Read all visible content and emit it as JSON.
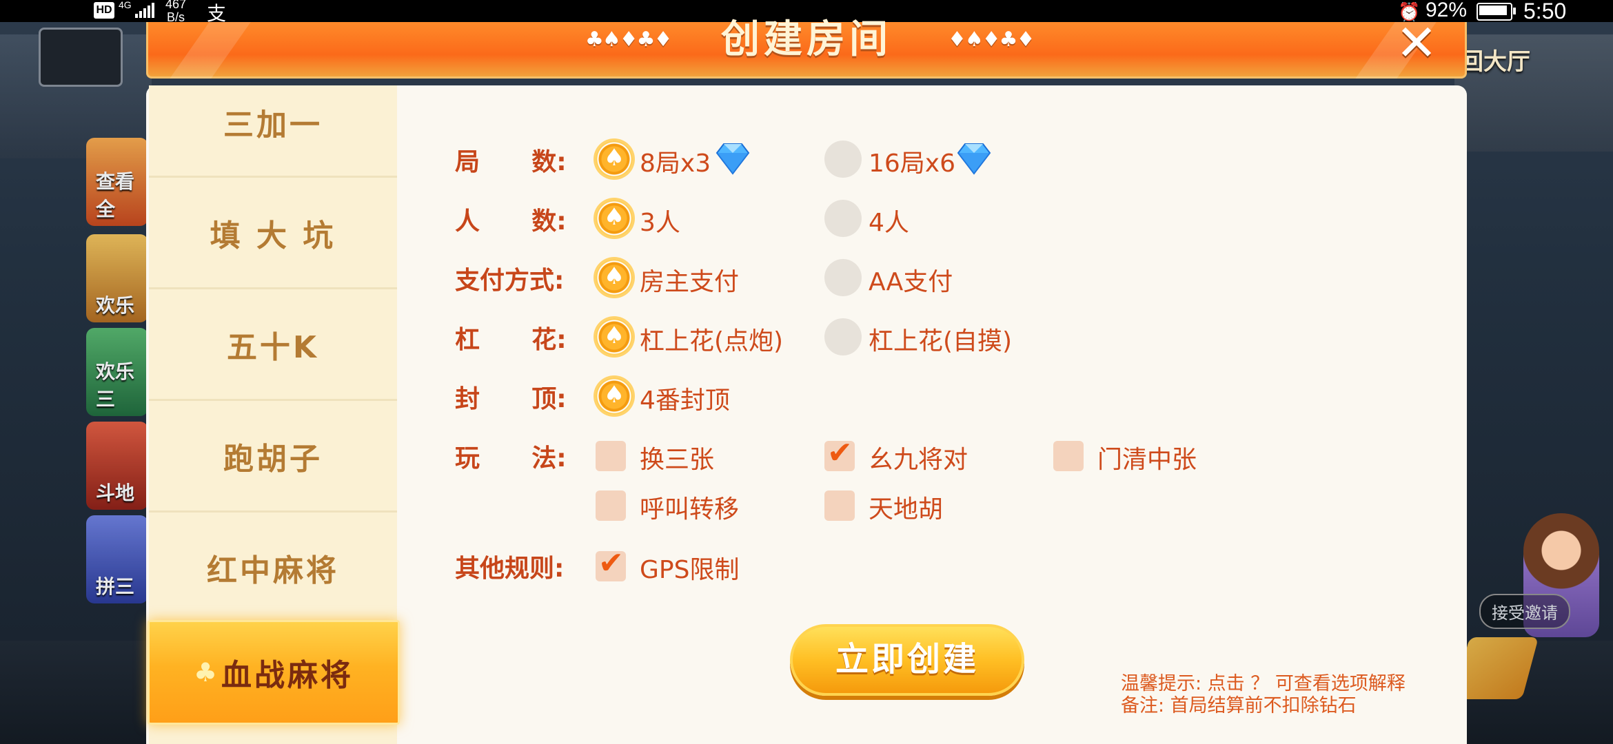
{
  "status_bar": {
    "hd": "HD",
    "network": "4G",
    "speed_value": "467",
    "speed_unit": "B/s",
    "payment_glyph": "支",
    "battery": "92%",
    "time": "5:50"
  },
  "background": {
    "card_labels": [
      "查看全",
      "欢乐",
      "欢乐三",
      "斗地",
      "拼三"
    ],
    "hall_label": "回大厅",
    "invite": "接受邀请"
  },
  "dialog": {
    "title": "创建房间",
    "suits_left": "♣♠♦♣♦",
    "suits_right": "♦♠♦♣♦",
    "close_icon": "close-icon"
  },
  "sidebar": {
    "items": [
      {
        "label": "三加一"
      },
      {
        "label": "填 大 坑"
      },
      {
        "label": "五十K"
      },
      {
        "label": "跑胡子"
      },
      {
        "label": "红中麻将"
      },
      {
        "label": "血战麻将",
        "active": true
      }
    ]
  },
  "options": {
    "rounds": {
      "label": "局      数:",
      "choices": [
        "8局x3",
        "16局x6"
      ],
      "selected": 0
    },
    "players": {
      "label": "人      数:",
      "choices": [
        "3人",
        "4人"
      ],
      "selected": 0
    },
    "payment": {
      "label": "支付方式:",
      "choices": [
        "房主支付",
        "AA支付"
      ],
      "selected": 0
    },
    "gang_flower": {
      "label": "杠      花:",
      "choices": [
        "杠上花(点炮)",
        "杠上花(自摸)"
      ],
      "selected": 0
    },
    "cap": {
      "label": "封      顶:",
      "choices": [
        "4番封顶"
      ],
      "selected": 0
    },
    "play": {
      "label": "玩      法:",
      "items": [
        {
          "label": "换三张",
          "checked": false
        },
        {
          "label": "幺九将对",
          "checked": true
        },
        {
          "label": "门清中张",
          "checked": false
        },
        {
          "label": "呼叫转移",
          "checked": false
        },
        {
          "label": "天地胡",
          "checked": false
        }
      ]
    },
    "other": {
      "label": "其他规则:",
      "items": [
        {
          "label": "GPS限制",
          "checked": true
        }
      ]
    }
  },
  "create_button": "立即创建",
  "tips": {
    "line1": "温馨提示: 点击 ？ 可查看选项解释",
    "line2": "备注: 首局结算前不扣除钻石"
  },
  "colors": {
    "accent": "#c7461a",
    "header": "#fb6a1a",
    "sidebar_bg": "#fbf1d4",
    "active_tab": "#ffb222"
  }
}
